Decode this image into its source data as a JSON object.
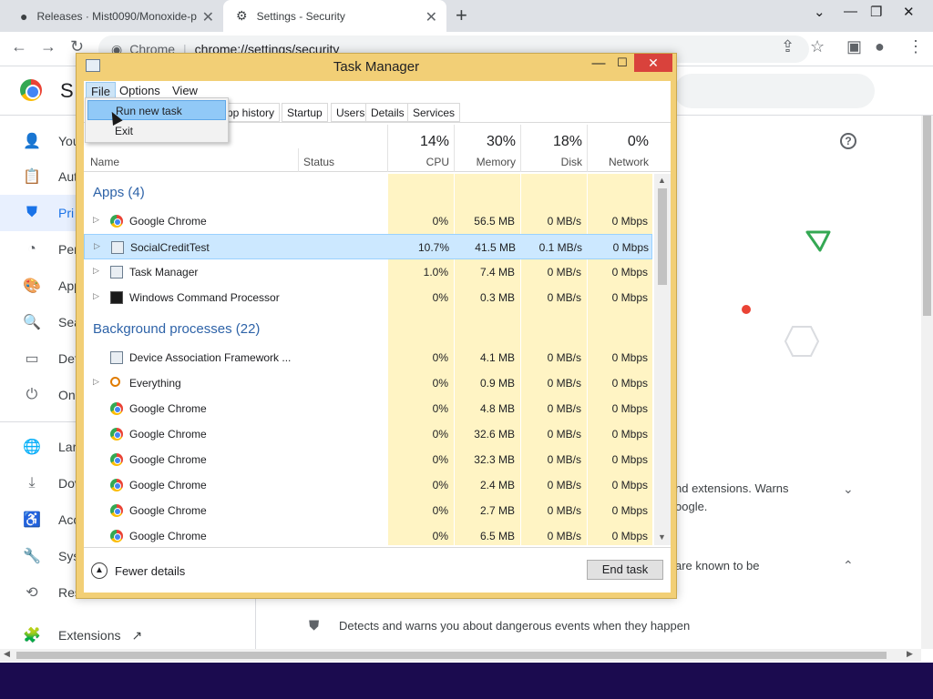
{
  "browser": {
    "tabs": [
      {
        "title": "Releases · Mist0090/Monoxide-p",
        "icon": "github-icon"
      },
      {
        "title": "Settings - Security",
        "icon": "gear-icon"
      }
    ],
    "omnibox": {
      "site": "Chrome",
      "url": "chrome://settings/security"
    }
  },
  "settings": {
    "title": "S",
    "sidebar": [
      {
        "label": "You",
        "icon": "person-icon"
      },
      {
        "label": "Aut",
        "icon": "clipboard-icon"
      },
      {
        "label": "Pri",
        "icon": "shield-icon",
        "active": true
      },
      {
        "label": "Per",
        "icon": "gauge-icon"
      },
      {
        "label": "App",
        "icon": "palette-icon"
      },
      {
        "label": "Sea",
        "icon": "search-icon"
      },
      {
        "label": "Def",
        "icon": "browser-icon"
      },
      {
        "label": "On",
        "icon": "power-icon"
      },
      {
        "label": "Lar",
        "icon": "globe-icon"
      },
      {
        "label": "Dov",
        "icon": "download-icon"
      },
      {
        "label": "Acc",
        "icon": "accessibility-icon"
      },
      {
        "label": "Sys",
        "icon": "wrench-icon"
      },
      {
        "label": "Res",
        "icon": "restore-icon"
      }
    ],
    "extensions_label": "Extensions",
    "card_lines": [
      "nd extensions. Warns",
      "oogle.",
      "are known to be",
      "Detects and warns you about dangerous events when they happen"
    ],
    "accent": "#1a73e8"
  },
  "task_manager": {
    "title": "Task Manager",
    "menu": [
      "File",
      "Options",
      "View"
    ],
    "file_menu": [
      "Run new task",
      "Exit"
    ],
    "tabs": [
      "pp history",
      "Startup",
      "Users",
      "Details",
      "Services"
    ],
    "columns": {
      "name": "Name",
      "status": "Status",
      "cpu": {
        "pct": "14%",
        "label": "CPU"
      },
      "memory": {
        "pct": "30%",
        "label": "Memory"
      },
      "disk": {
        "pct": "18%",
        "label": "Disk"
      },
      "network": {
        "pct": "0%",
        "label": "Network"
      }
    },
    "groups": {
      "apps": "Apps (4)",
      "background": "Background processes (22)"
    },
    "apps": [
      {
        "name": "Google Chrome",
        "icon": "chrome-icon",
        "cpu": "0%",
        "mem": "56.5 MB",
        "disk": "0 MB/s",
        "net": "0 Mbps"
      },
      {
        "name": "SocialCreditTest",
        "icon": "window-icon",
        "cpu": "10.7%",
        "mem": "41.5 MB",
        "disk": "0.1 MB/s",
        "net": "0 Mbps",
        "selected": true
      },
      {
        "name": "Task Manager",
        "icon": "taskmgr-icon",
        "cpu": "1.0%",
        "mem": "7.4 MB",
        "disk": "0 MB/s",
        "net": "0 Mbps"
      },
      {
        "name": "Windows Command Processor",
        "icon": "cmd-icon",
        "cpu": "0%",
        "mem": "0.3 MB",
        "disk": "0 MB/s",
        "net": "0 Mbps"
      }
    ],
    "background": [
      {
        "name": "Device Association Framework ...",
        "icon": "window-icon",
        "cpu": "0%",
        "mem": "4.1 MB",
        "disk": "0 MB/s",
        "net": "0 Mbps"
      },
      {
        "name": "Everything",
        "icon": "search-icon",
        "cpu": "0%",
        "mem": "0.9 MB",
        "disk": "0 MB/s",
        "net": "0 Mbps"
      },
      {
        "name": "Google Chrome",
        "icon": "chrome-icon",
        "cpu": "0%",
        "mem": "4.8 MB",
        "disk": "0 MB/s",
        "net": "0 Mbps"
      },
      {
        "name": "Google Chrome",
        "icon": "chrome-icon",
        "cpu": "0%",
        "mem": "32.6 MB",
        "disk": "0 MB/s",
        "net": "0 Mbps"
      },
      {
        "name": "Google Chrome",
        "icon": "chrome-icon",
        "cpu": "0%",
        "mem": "32.3 MB",
        "disk": "0 MB/s",
        "net": "0 Mbps"
      },
      {
        "name": "Google Chrome",
        "icon": "chrome-icon",
        "cpu": "0%",
        "mem": "2.4 MB",
        "disk": "0 MB/s",
        "net": "0 Mbps"
      },
      {
        "name": "Google Chrome",
        "icon": "chrome-icon",
        "cpu": "0%",
        "mem": "2.7 MB",
        "disk": "0 MB/s",
        "net": "0 Mbps"
      },
      {
        "name": "Google Chrome",
        "icon": "chrome-icon",
        "cpu": "0%",
        "mem": "6.5 MB",
        "disk": "0 MB/s",
        "net": "0 Mbps"
      }
    ],
    "footer": {
      "fewer_details": "Fewer details",
      "end_task": "End task"
    },
    "colors": {
      "title_bar": "#f2cf76",
      "close": "#d9423c",
      "heat": "#fff4c4",
      "selection": "#cce8ff",
      "group": "#2e63a8"
    }
  }
}
